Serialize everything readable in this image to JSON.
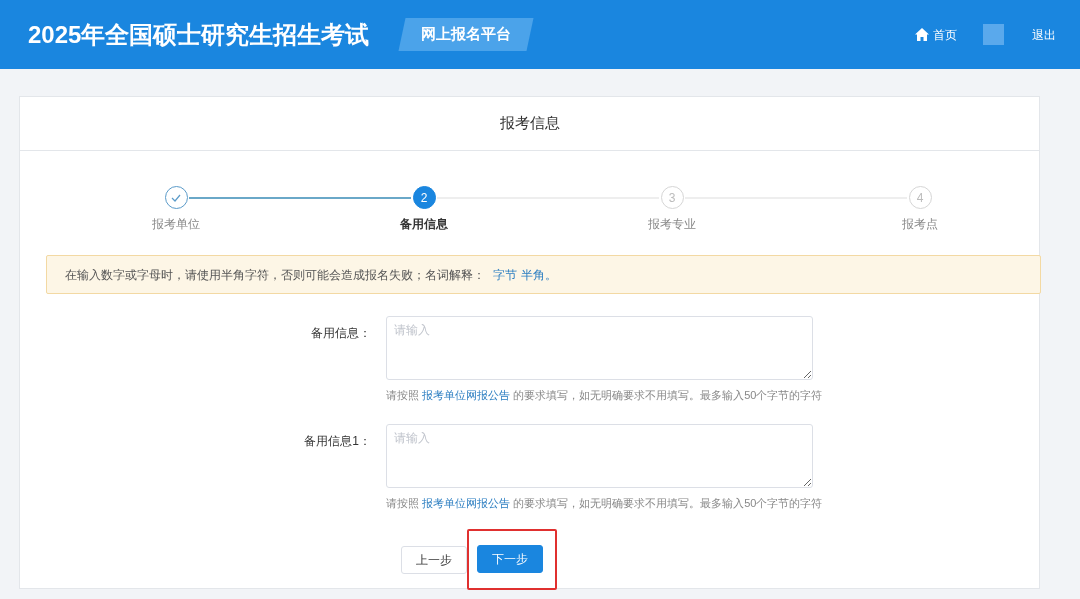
{
  "header": {
    "title": "2025年全国硕士研究生招生考试",
    "badge": "网上报名平台",
    "nav": [
      {
        "kind": "home",
        "label": "首页"
      },
      {
        "kind": "avatar"
      },
      {
        "kind": "text",
        "label": "退出"
      }
    ]
  },
  "card": {
    "title": "报考信息",
    "steps": [
      {
        "label": "报考单位",
        "completed": true,
        "selected": false
      },
      {
        "number": "2",
        "label": "备用信息",
        "completed": false,
        "selected": true
      },
      {
        "number": "3",
        "label": "报考专业",
        "completed": false,
        "selected": false
      },
      {
        "number": "4",
        "label": "报考点",
        "completed": false,
        "selected": false
      }
    ],
    "notice": {
      "text": "在输入数字或字母时，请使用半角字符，否则可能会造成报名失败；名词解释：",
      "links": [
        "字节",
        "半角"
      ],
      "end": "。"
    },
    "fields": [
      {
        "label": "备用信息：",
        "placeholder": "请输入",
        "hint_prefix": "请按照",
        "hint_link": "报考单位网报公告",
        "hint_suffix": "的要求填写，如无明确要求不用填写。最多输入50个字节的字符"
      },
      {
        "label": "备用信息1：",
        "placeholder": "请输入",
        "hint_prefix": "请按照",
        "hint_link": "报考单位网报公告",
        "hint_suffix": "的要求填写，如无明确要求不用填写。最多输入50个字节的字符"
      }
    ],
    "buttons": [
      {
        "label": "上一步",
        "kind": "secondary",
        "highlighted": false
      },
      {
        "label": "下一步",
        "kind": "primary",
        "highlighted": true
      }
    ]
  }
}
